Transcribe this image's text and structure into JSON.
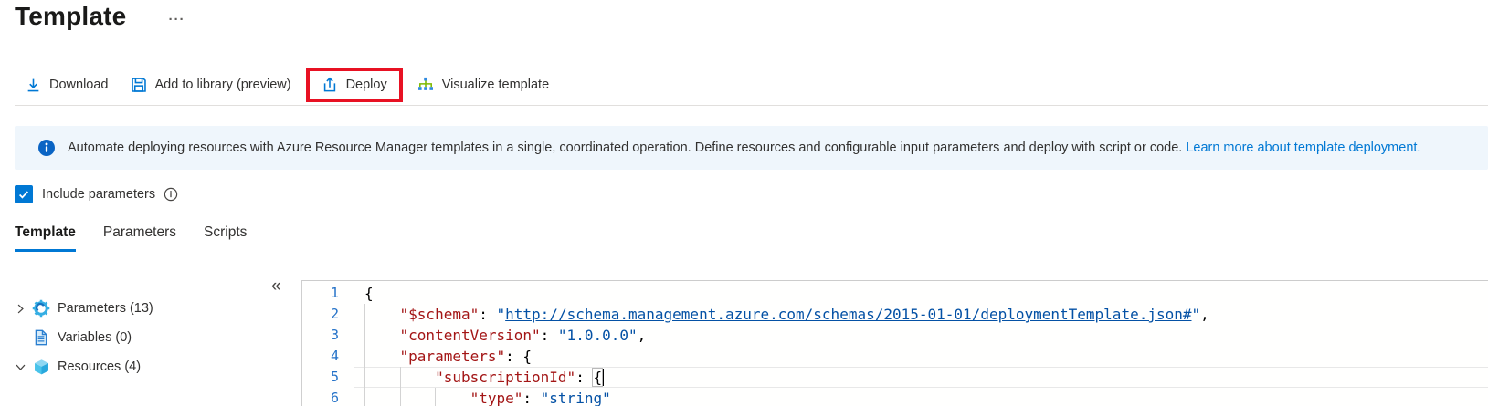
{
  "header": {
    "title": "Template",
    "more_icon": "···"
  },
  "toolbar": {
    "download_label": "Download",
    "add_to_library_label": "Add to library (preview)",
    "deploy_label": "Deploy",
    "visualize_label": "Visualize template"
  },
  "banner": {
    "message": "Automate deploying resources with Azure Resource Manager templates in a single, coordinated operation. Define resources and configurable input parameters and deploy with script or code.",
    "link_label": "Learn more about template deployment."
  },
  "options": {
    "include_parameters_label": "Include parameters",
    "checked": true
  },
  "tabs": {
    "items": [
      {
        "label": "Template",
        "active": true
      },
      {
        "label": "Parameters",
        "active": false
      },
      {
        "label": "Scripts",
        "active": false
      }
    ]
  },
  "tree": {
    "collapse_icon": "«",
    "items": [
      {
        "label": "Parameters (13)",
        "icon": "gear-icon",
        "expanded": false,
        "has_chevron": true
      },
      {
        "label": "Variables (0)",
        "icon": "document-icon",
        "expanded": false,
        "has_chevron": false
      },
      {
        "label": "Resources (4)",
        "icon": "cube-icon",
        "expanded": true,
        "has_chevron": true
      }
    ]
  },
  "editor": {
    "current_line": 5,
    "lines": [
      {
        "n": "1",
        "segs": [
          {
            "t": "{",
            "c": "p"
          }
        ]
      },
      {
        "n": "2",
        "segs": [
          {
            "t": "    ",
            "c": "p"
          },
          {
            "t": "\"$schema\"",
            "c": "k"
          },
          {
            "t": ": ",
            "c": "p"
          },
          {
            "t": "\"",
            "c": "s"
          },
          {
            "t": "http://schema.management.azure.com/schemas/2015-01-01/deploymentTemplate.json#",
            "c": "l"
          },
          {
            "t": "\"",
            "c": "s"
          },
          {
            "t": ",",
            "c": "p"
          }
        ]
      },
      {
        "n": "3",
        "segs": [
          {
            "t": "    ",
            "c": "p"
          },
          {
            "t": "\"contentVersion\"",
            "c": "k"
          },
          {
            "t": ": ",
            "c": "p"
          },
          {
            "t": "\"1.0.0.0\"",
            "c": "s"
          },
          {
            "t": ",",
            "c": "p"
          }
        ]
      },
      {
        "n": "4",
        "segs": [
          {
            "t": "    ",
            "c": "p"
          },
          {
            "t": "\"parameters\"",
            "c": "k"
          },
          {
            "t": ": ",
            "c": "p"
          },
          {
            "t": "{",
            "c": "p"
          }
        ]
      },
      {
        "n": "5",
        "segs": [
          {
            "t": "        ",
            "c": "p"
          },
          {
            "t": "\"subscriptionId\"",
            "c": "k"
          },
          {
            "t": ": ",
            "c": "p"
          },
          {
            "t": "{",
            "c": "m",
            "caret": true
          }
        ]
      },
      {
        "n": "6",
        "segs": [
          {
            "t": "            ",
            "c": "p"
          },
          {
            "t": "\"type\"",
            "c": "k"
          },
          {
            "t": ": ",
            "c": "p"
          },
          {
            "t": "\"string\"",
            "c": "s"
          }
        ]
      }
    ]
  },
  "colors": {
    "accent": "#0078d4",
    "highlight_red": "#e81123",
    "banner_bg": "#eff6fc",
    "json_key": "#a31515",
    "json_value": "#0451a5",
    "line_number": "#2472c8"
  }
}
